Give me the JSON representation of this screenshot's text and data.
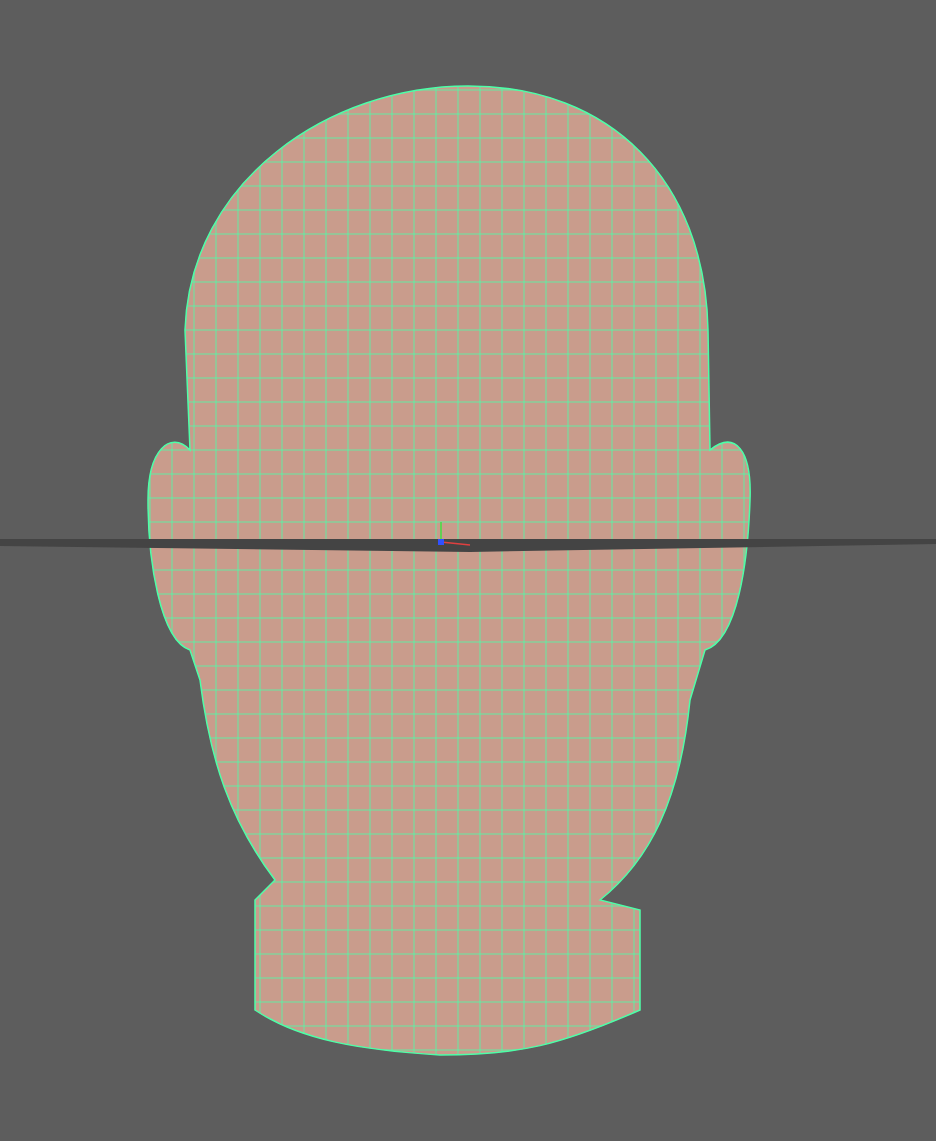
{
  "viewport": {
    "wireframe_on_shaded": true,
    "ground_grid": true,
    "axis_gizmo": true
  }
}
